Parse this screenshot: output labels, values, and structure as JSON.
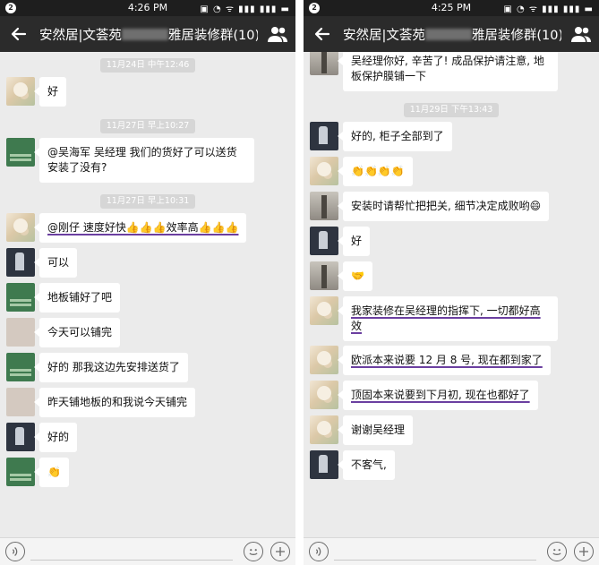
{
  "left": {
    "status": {
      "badge": "2",
      "time": "4:26 PM",
      "icons": "▣ ◔ ᯤ ▮▮▮ ▮▮▮ ▬"
    },
    "title": {
      "prefix": "安然居|文荟苑",
      "suffix": "雅居装修群(10)"
    },
    "items": [
      {
        "kind": "time",
        "text": "11月24日 中午12:46"
      },
      {
        "kind": "msg",
        "avatar": "flower",
        "text": "好"
      },
      {
        "kind": "time",
        "text": "11月27日 早上10:27"
      },
      {
        "kind": "msg",
        "avatar": "green",
        "text": "@吴海军  吴经理 我们的货好了可以送货安装了没有?"
      },
      {
        "kind": "time",
        "text": "11月27日 早上10:31"
      },
      {
        "kind": "msg",
        "avatar": "flower",
        "text": "@刚仔  速度好快👍👍👍效率高👍👍👍",
        "underline": true
      },
      {
        "kind": "msg",
        "avatar": "dark",
        "text": "可以"
      },
      {
        "kind": "msg",
        "avatar": "green",
        "text": "地板铺好了吧"
      },
      {
        "kind": "msg",
        "avatar": "blur",
        "text": "今天可以铺完"
      },
      {
        "kind": "msg",
        "avatar": "green",
        "text": "好的  那我这边先安排送货了"
      },
      {
        "kind": "msg",
        "avatar": "blur",
        "text": "昨天铺地板的和我说今天铺完"
      },
      {
        "kind": "msg",
        "avatar": "dark",
        "text": "好的"
      },
      {
        "kind": "msg",
        "avatar": "green",
        "text": "👏"
      }
    ]
  },
  "right": {
    "status": {
      "badge": "2",
      "time": "4:25 PM",
      "icons": "▣ ◔ ᯤ ▮▮▮ ▮▮▮ ▬"
    },
    "title": {
      "prefix": "安然居|文荟苑",
      "suffix": "雅居装修群(10)"
    },
    "items": [
      {
        "kind": "msg",
        "avatar": "tower",
        "text": "吴经理你好, 辛苦了! 成品保护请注意, 地板保护膜铺一下"
      },
      {
        "kind": "time",
        "text": "11月29日 下午13:43"
      },
      {
        "kind": "msg",
        "avatar": "dark",
        "text": "好的, 柜子全部到了"
      },
      {
        "kind": "msg",
        "avatar": "flower",
        "text": "👏👏👏👏"
      },
      {
        "kind": "msg",
        "avatar": "tower",
        "text": "安装时请帮忙把把关, 细节决定成败哟😄"
      },
      {
        "kind": "msg",
        "avatar": "dark",
        "text": "好"
      },
      {
        "kind": "msg",
        "avatar": "tower",
        "text": "🤝"
      },
      {
        "kind": "msg",
        "avatar": "flower",
        "text": "我家装修在吴经理的指挥下, 一切都好高效",
        "underline": true
      },
      {
        "kind": "msg",
        "avatar": "flower",
        "text": "欧派本来说要 12 月 8 号, 现在都到家了",
        "underline": true
      },
      {
        "kind": "msg",
        "avatar": "flower",
        "text": "顶固本来说要到下月初, 现在也都好了",
        "underline": true
      },
      {
        "kind": "msg",
        "avatar": "flower",
        "text": "谢谢吴经理"
      },
      {
        "kind": "msg",
        "avatar": "dark",
        "text": "不客气,"
      }
    ]
  }
}
